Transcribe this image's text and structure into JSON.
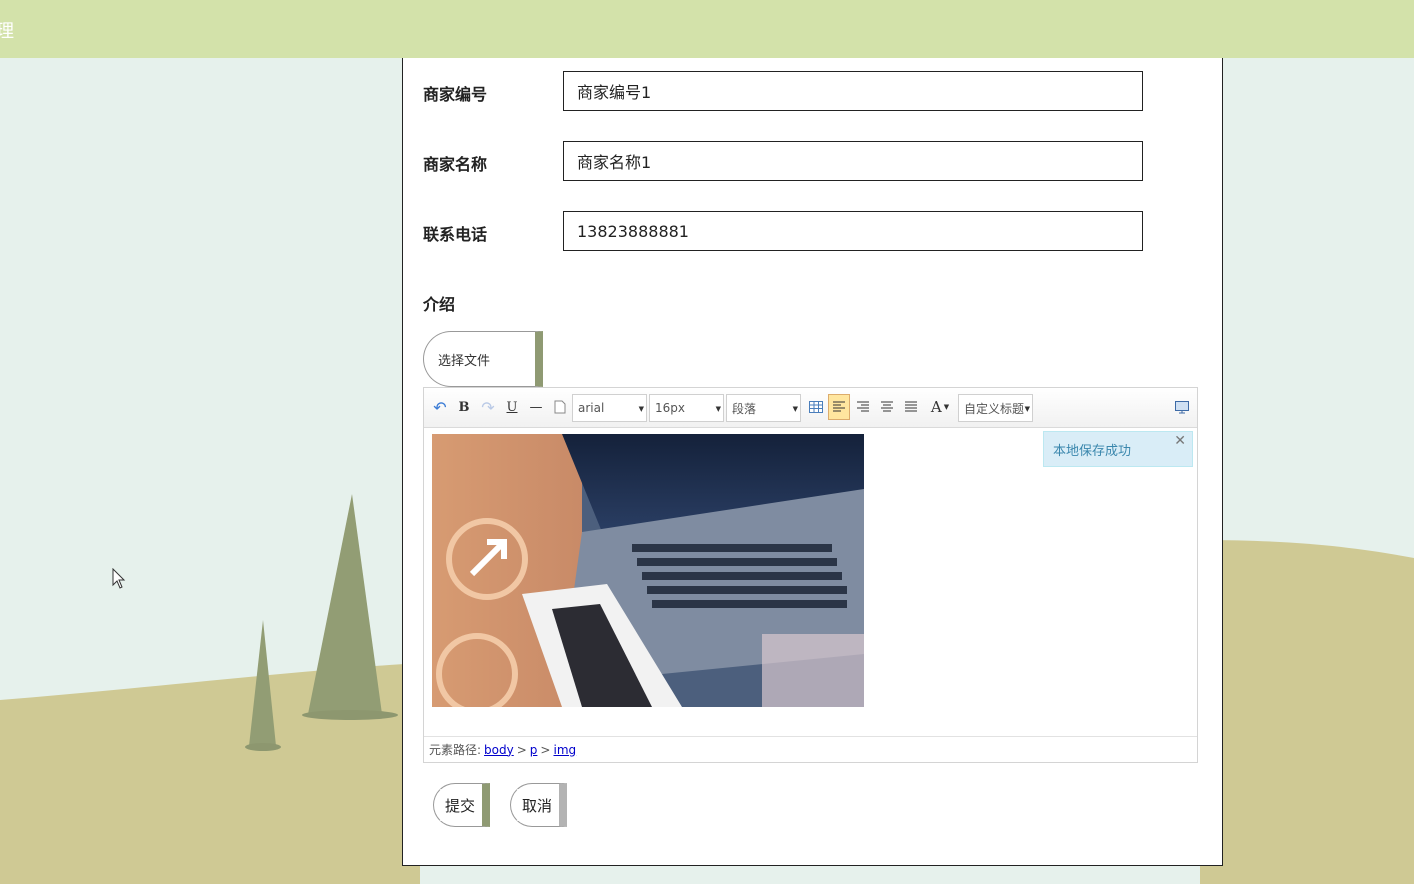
{
  "topbar": {
    "edge_char": "理"
  },
  "form": {
    "merchant_no": {
      "label": "商家编号",
      "value": "商家编号1"
    },
    "merchant_name": {
      "label": "商家名称",
      "value": "商家名称1"
    },
    "phone": {
      "label": "联系电话",
      "value": "13823888881"
    },
    "intro_label": "介绍",
    "file_button": "选择文件"
  },
  "editor": {
    "toolbar": {
      "undo": "↶",
      "bold": "B",
      "redo": "↷",
      "underline": "U",
      "hr": "—",
      "font_family": "arial",
      "font_size": "16px",
      "paragraph": "段落",
      "font_color": "A",
      "custom_title": "自定义标题"
    },
    "toast": {
      "message": "本地保存成功",
      "close": "✕"
    },
    "path": {
      "label": "元素路径:",
      "items": [
        "body",
        "p",
        "img"
      ],
      "separator": ">"
    }
  },
  "actions": {
    "submit": "提交",
    "cancel": "取消"
  },
  "colors": {
    "topbar": "#d3e2aa",
    "sky": "#e6f1ec",
    "ground": "#cfc994",
    "tree": "#929d74",
    "toast_bg": "#d9edf7"
  }
}
